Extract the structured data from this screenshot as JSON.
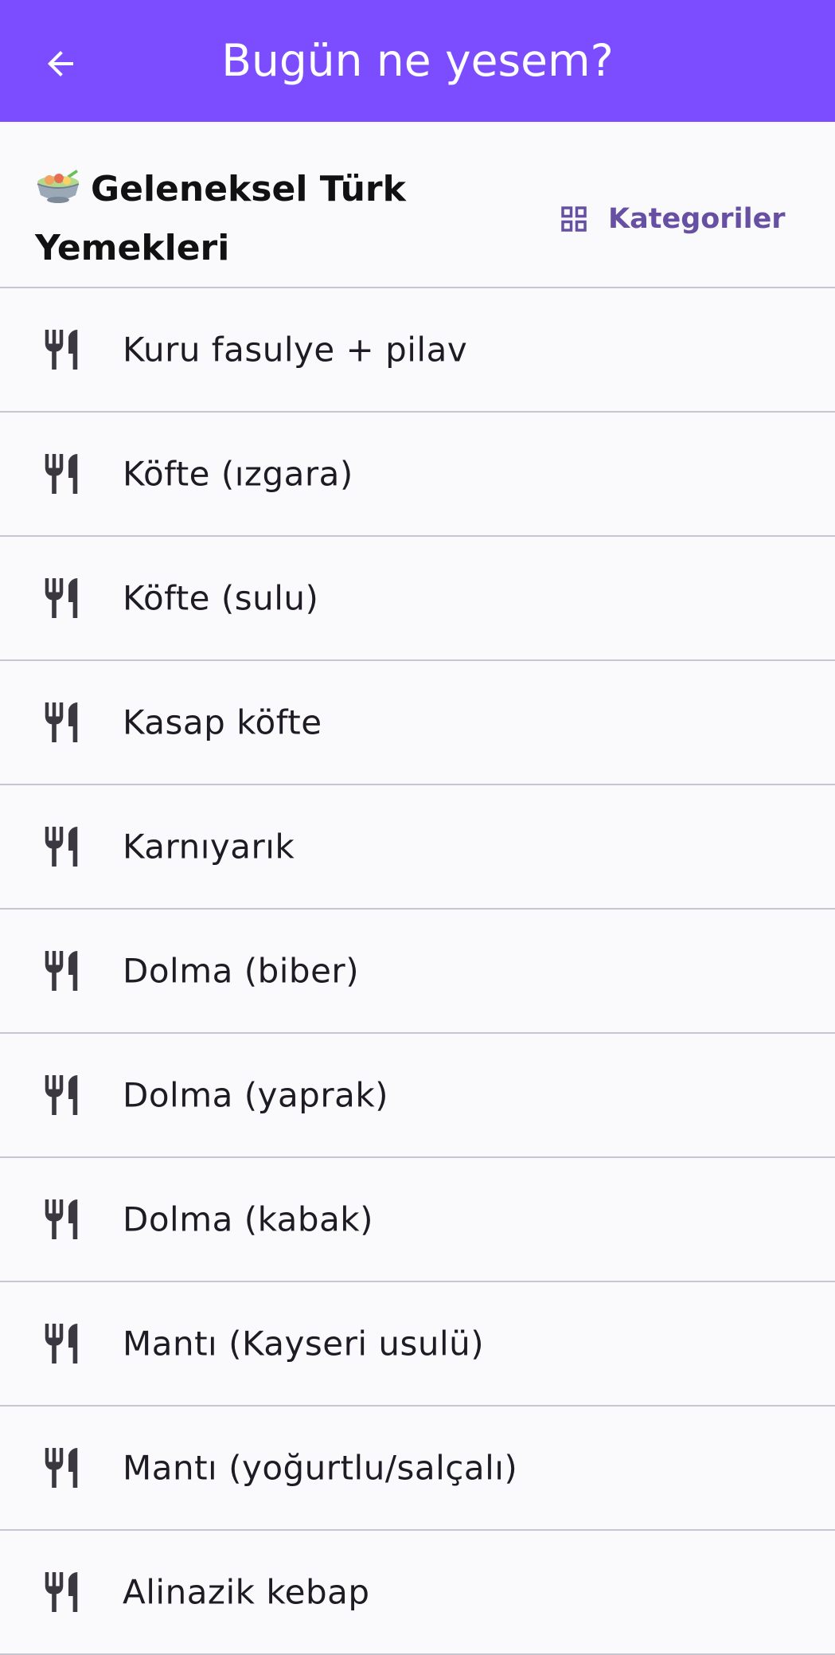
{
  "app_bar": {
    "title": "Bugün ne yesem?",
    "background": "#7c4dff",
    "back_icon": "arrow-back-icon"
  },
  "section": {
    "title": "Geleneksel Türk Yemekleri",
    "emoji_icon": "bowl-icon",
    "categories_label": "Kategoriler",
    "categories_icon": "grid-icon",
    "accent": "#6750a4"
  },
  "items": [
    {
      "label": "Kuru fasulye + pilav"
    },
    {
      "label": "Köfte (ızgara)"
    },
    {
      "label": "Köfte (sulu)"
    },
    {
      "label": "Kasap köfte"
    },
    {
      "label": "Karnıyarık"
    },
    {
      "label": "Dolma (biber)"
    },
    {
      "label": "Dolma (yaprak)"
    },
    {
      "label": "Dolma (kabak)"
    },
    {
      "label": "Mantı (Kayseri usulü)"
    },
    {
      "label": "Mantı (yoğurtlu/salçalı)"
    },
    {
      "label": "Alinazik kebap"
    }
  ],
  "item_icon": "restaurant-icon"
}
